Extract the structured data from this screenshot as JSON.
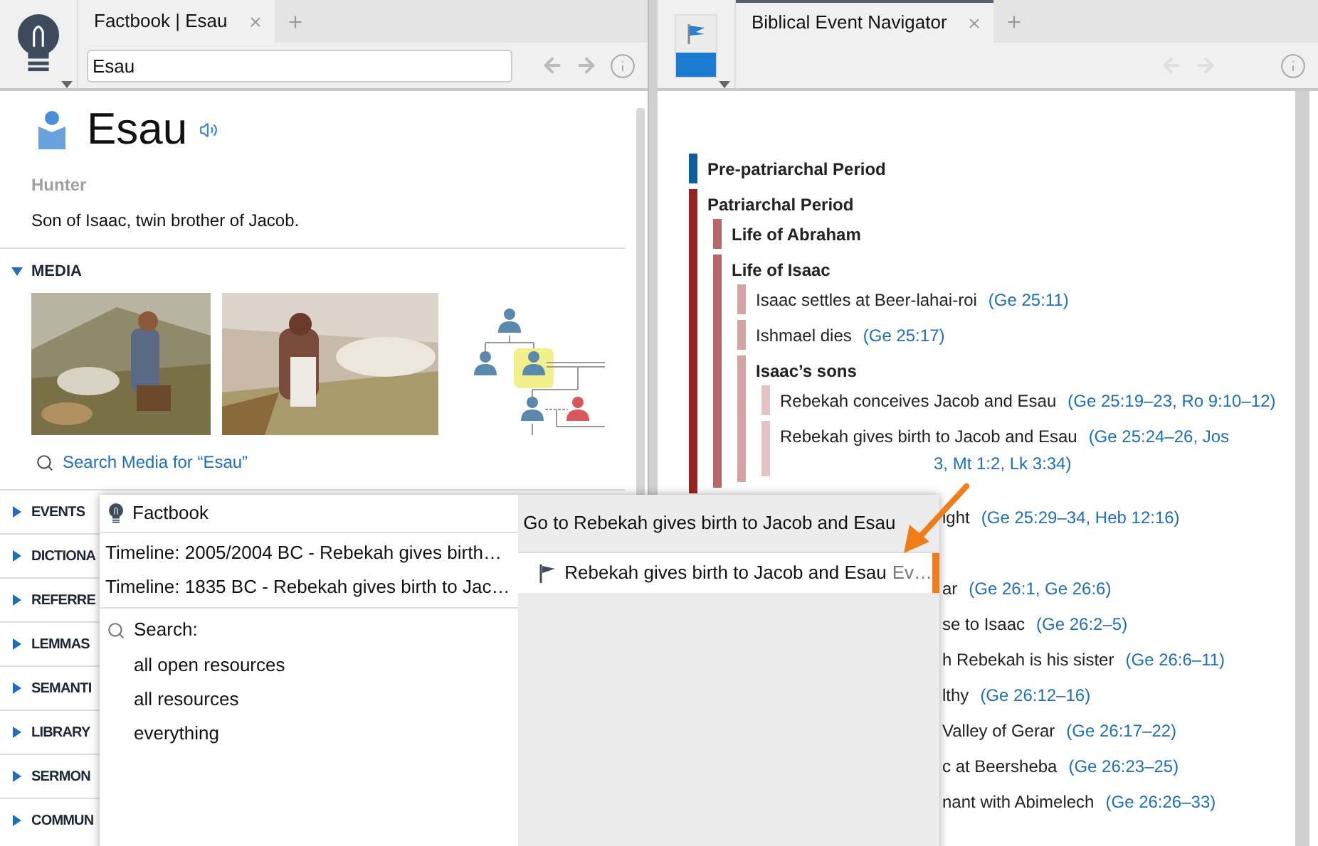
{
  "left_panel": {
    "tab": {
      "label": "Factbook | Esau",
      "selected": true
    },
    "search": {
      "value": "Esau"
    },
    "title": "Esau",
    "subtitle": "Hunter",
    "description": "Son of Isaac, twin brother of Jacob.",
    "media": {
      "label": "MEDIA",
      "expanded": true,
      "search_link": "Search Media for “Esau”"
    },
    "sections": [
      {
        "label": "EVENTS",
        "expanded": false
      },
      {
        "label": "DICTIONA",
        "expanded": false
      },
      {
        "label": "REFERRE",
        "expanded": false
      },
      {
        "label": "LEMMAS",
        "expanded": false
      },
      {
        "label": "SEMANTI",
        "expanded": false
      },
      {
        "label": "LIBRARY",
        "expanded": false
      },
      {
        "label": "SERMON",
        "expanded": false
      },
      {
        "label": "COMMUN",
        "expanded": false
      }
    ]
  },
  "right_panel": {
    "tab": {
      "label": "Biblical Event Navigator",
      "selected": true
    },
    "events": [
      {
        "label": "Pre-patriarchal Period",
        "bold": true,
        "color": "#0d5c9c"
      },
      {
        "label": "Patriarchal Period",
        "bold": true,
        "color": "#962424",
        "children": [
          {
            "label": "Life of Abraham",
            "bold": true,
            "color": "#b86868"
          },
          {
            "label": "Life of Isaac",
            "bold": true,
            "color": "#b86868",
            "children": [
              {
                "label": "Isaac settles at Beer-lahai-roi",
                "ref": "(Ge 25:11)",
                "bold": false,
                "color": "#d4a3a3"
              },
              {
                "label": "Ishmael dies",
                "ref": "(Ge 25:17)",
                "bold": false,
                "color": "#d4a3a3"
              },
              {
                "label": "Isaac’s sons",
                "bold": true,
                "color": "#d4a3a3",
                "children": [
                  {
                    "label": "Rebekah conceives Jacob and Esau",
                    "ref": "(Ge 25:19–23, Ro 9:10–12)",
                    "bold": false,
                    "color": "#e6c3c3"
                  },
                  {
                    "label": "Rebekah gives birth to Jacob and Esau",
                    "ref": "(Ge 25:24–26, Jos",
                    "ref_continued": "3, Mt 1:2, Lk 3:34)",
                    "bold": false,
                    "color": "#e6c3c3"
                  }
                ]
              }
            ]
          }
        ]
      }
    ],
    "covered_rows": [
      {
        "text": "ight",
        "ref": "(Ge 25:29–34, Heb 12:16)"
      },
      {
        "text": "ar",
        "ref": "(Ge 26:1, Ge 26:6)"
      },
      {
        "text": "se to Isaac",
        "ref": "(Ge 26:2–5)"
      },
      {
        "text": "h Rebekah is his sister",
        "ref": "(Ge 26:6–11)"
      },
      {
        "text": "lthy",
        "ref": "(Ge 26:12–16)"
      },
      {
        "text": "Valley of Gerar",
        "ref": "(Ge 26:17–22)"
      },
      {
        "text": "c at Beersheba",
        "ref": "(Ge 26:23–25)"
      },
      {
        "text": "nant with Abimelech",
        "ref": "(Ge 26:26–33)"
      }
    ]
  },
  "popup": {
    "header": "Factbook",
    "timelines": [
      "Timeline: 2005/2004 BC - Rebekah gives birth…",
      "Timeline: 1835 BC - Rebekah gives birth to Jac…"
    ],
    "search_label": "Search:",
    "search_options": [
      "all open resources",
      "all resources",
      "everything"
    ],
    "go_to": {
      "label": "Go to Rebekah gives birth to Jacob and Esau",
      "result": {
        "text": "Rebekah gives birth to Jacob and Esau",
        "type_label": "Ev…",
        "selected": true
      }
    }
  }
}
